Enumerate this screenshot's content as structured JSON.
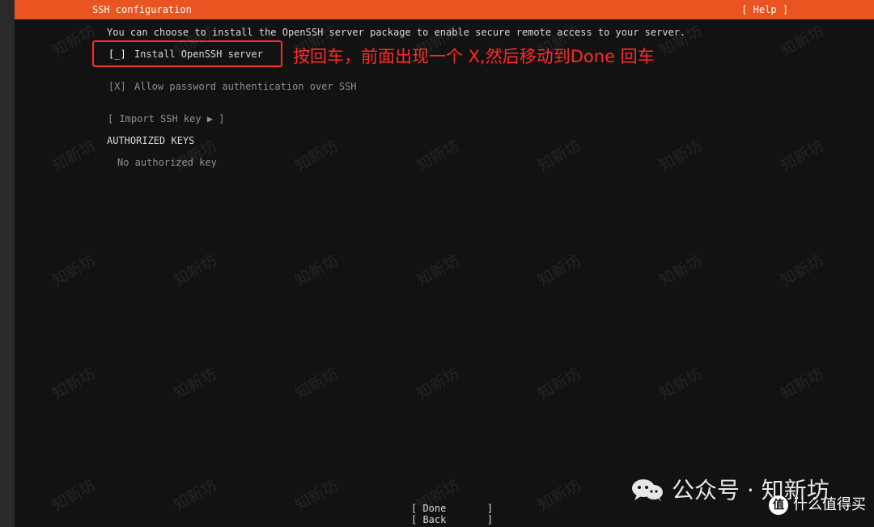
{
  "window": {
    "title": "SSH configuration",
    "help_label": "[ Help ]"
  },
  "main": {
    "description": "You can choose to install the OpenSSH server package to enable secure remote access to your server.",
    "install_checkbox": "[_]",
    "install_label": "Install OpenSSH server",
    "allow_checkbox": "[X]",
    "allow_label": "Allow password authentication over SSH",
    "import_ssh_key_label": "[ Import SSH key ▶ ]",
    "authorized_keys_heading": "AUTHORIZED KEYS",
    "no_key_text": "No authorized key"
  },
  "footer": {
    "done_button": "[ Done       ]",
    "back_button": "[ Back       ]"
  },
  "annotation": {
    "text": "按回车，前面出现一个 X,然后移动到Done 回车"
  },
  "branding": {
    "watermark_text": "知新坊",
    "wechat_label": "公众号 · 知新坊",
    "site_icon": "值",
    "site_label": "什么值得买"
  },
  "colors": {
    "topbar": "#e95420",
    "background": "#121212",
    "annotation": "#ff2a2a"
  }
}
